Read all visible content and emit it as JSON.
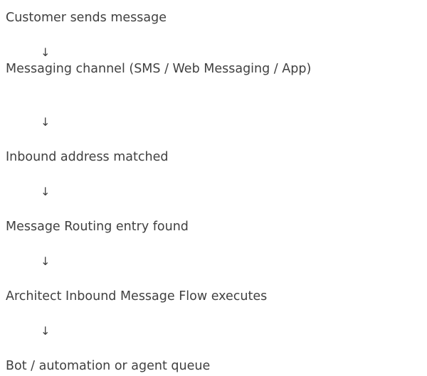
{
  "diagram": {
    "steps": [
      "Customer sends message",
      "Messaging channel (SMS / Web Messaging / App)",
      "Inbound address matched",
      "Message Routing entry found",
      "Architect Inbound Message Flow executes",
      "Bot / automation or agent queue"
    ],
    "arrow_glyph": "↓"
  }
}
